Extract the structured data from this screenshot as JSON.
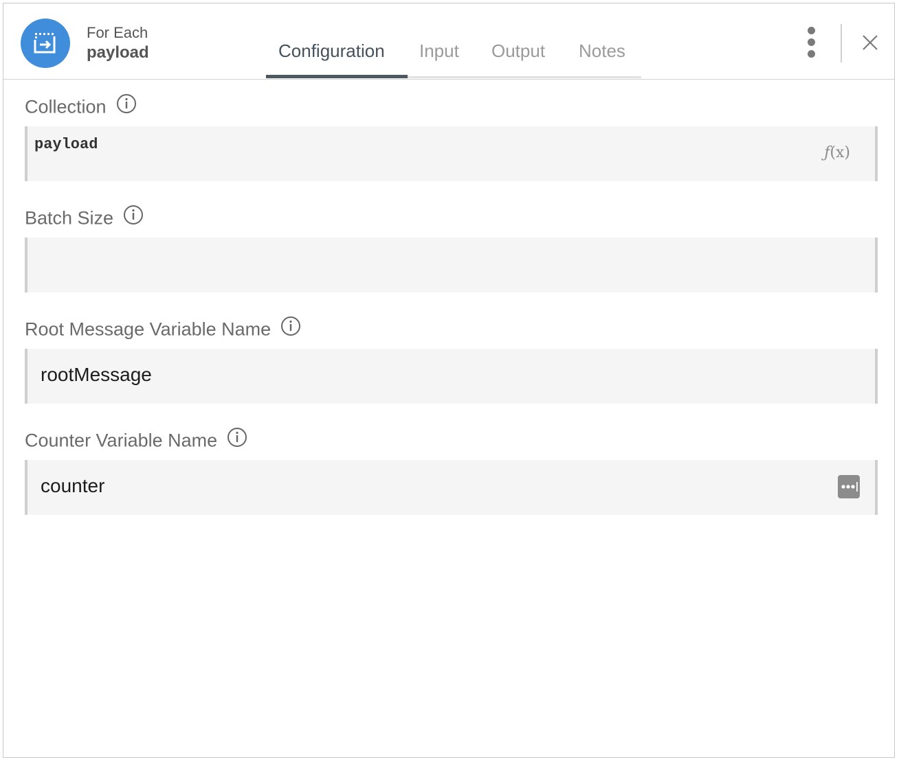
{
  "header": {
    "subtitle": "For Each",
    "title": "payload",
    "icon": "for-each-icon",
    "accent_color": "#3f8ddb"
  },
  "tabs": [
    {
      "label": "Configuration",
      "active": true
    },
    {
      "label": "Input",
      "active": false
    },
    {
      "label": "Output",
      "active": false
    },
    {
      "label": "Notes",
      "active": false
    }
  ],
  "fields": {
    "collection": {
      "label": "Collection",
      "value": "payload",
      "expression_button": "f(x)"
    },
    "batch_size": {
      "label": "Batch Size",
      "value": ""
    },
    "root_message": {
      "label": "Root Message Variable Name",
      "value": "rootMessage"
    },
    "counter": {
      "label": "Counter Variable Name",
      "value": "counter"
    }
  }
}
